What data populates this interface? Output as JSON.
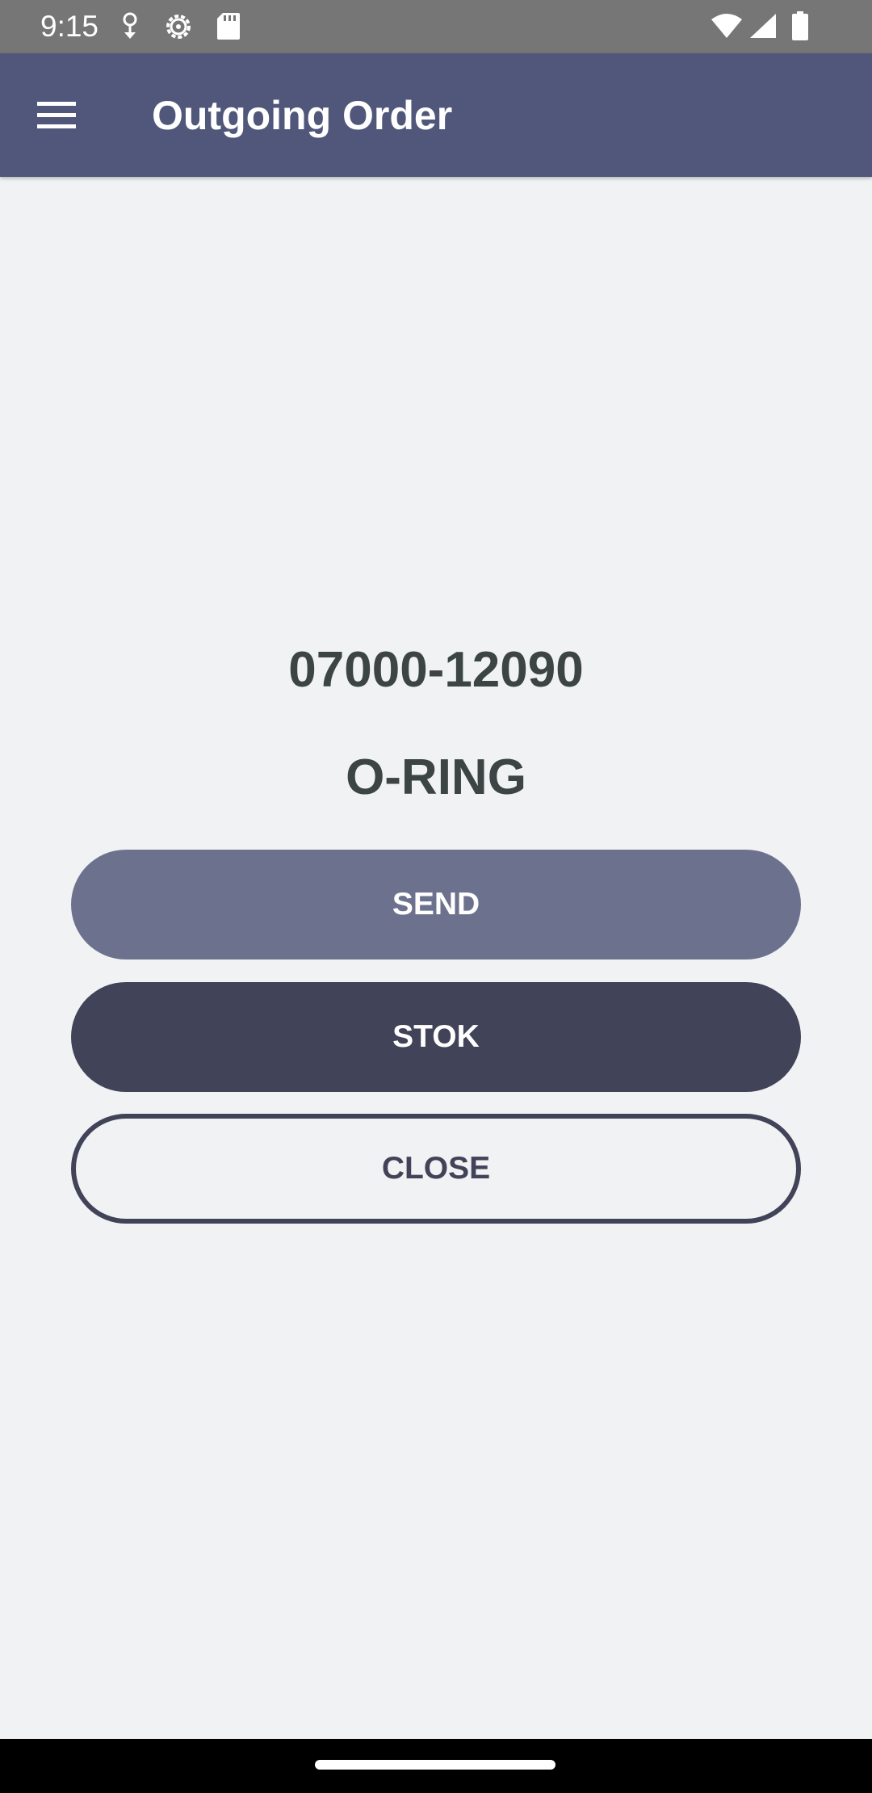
{
  "status_bar": {
    "time": "9:15",
    "icons": [
      "location-icon",
      "settings-icon",
      "sd-card-icon",
      "wifi-icon",
      "signal-icon",
      "battery-icon"
    ]
  },
  "app_bar": {
    "title": "Outgoing Order",
    "menu_icon": "hamburger-menu-icon",
    "background": "#50577a"
  },
  "content": {
    "part_number": "07000-12090",
    "part_name": "O-RING"
  },
  "buttons": {
    "send_label": "SEND",
    "stok_label": "STOK",
    "close_label": "CLOSE"
  },
  "colors": {
    "send_button": "#6c728e",
    "stok_button": "#414358",
    "close_border": "#414358",
    "page_background": "#f1f2f4"
  }
}
